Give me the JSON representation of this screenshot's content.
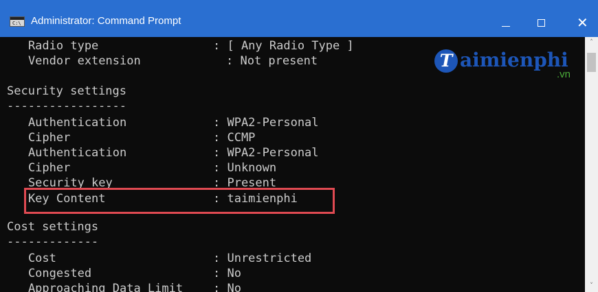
{
  "window": {
    "title": "Administrator: Command Prompt",
    "icon_glyph": "C:\\",
    "icons": {
      "app": "cmd-app-icon",
      "minimize": "minimize-icon",
      "maximize": "maximize-icon",
      "close": "close-icon"
    },
    "controls": {
      "minimize": "—",
      "maximize": "☐",
      "close": "✕"
    }
  },
  "console": {
    "lines": [
      {
        "label": "    Radio type",
        "value": ": [ Any Radio Type ]"
      },
      {
        "label": "    Vendor extension",
        "value": ": Not present"
      },
      {
        "text": "Security settings"
      },
      {
        "text": "-----------------"
      },
      {
        "label": "    Authentication",
        "value": ": WPA2-Personal"
      },
      {
        "label": "    Cipher",
        "value": ": CCMP"
      },
      {
        "label": "    Authentication",
        "value": ": WPA2-Personal"
      },
      {
        "label": "    Cipher",
        "value": ": Unknown"
      },
      {
        "label": "    Security key",
        "value": ": Present"
      },
      {
        "label": "    Key Content",
        "value": ": taimienphi"
      },
      {
        "text": "Cost settings"
      },
      {
        "text": "-------------"
      },
      {
        "label": "    Cost",
        "value": ": Unrestricted"
      },
      {
        "label": "    Congested",
        "value": ": No"
      },
      {
        "label": "    Approaching Data Limit",
        "value": ": No"
      }
    ],
    "highlight_color": "#e04a52"
  },
  "watermark": {
    "initial": "T",
    "text": "aimienphi",
    "domain": ".vn"
  },
  "scrollbar": {
    "up": "˄",
    "down": "˅"
  }
}
